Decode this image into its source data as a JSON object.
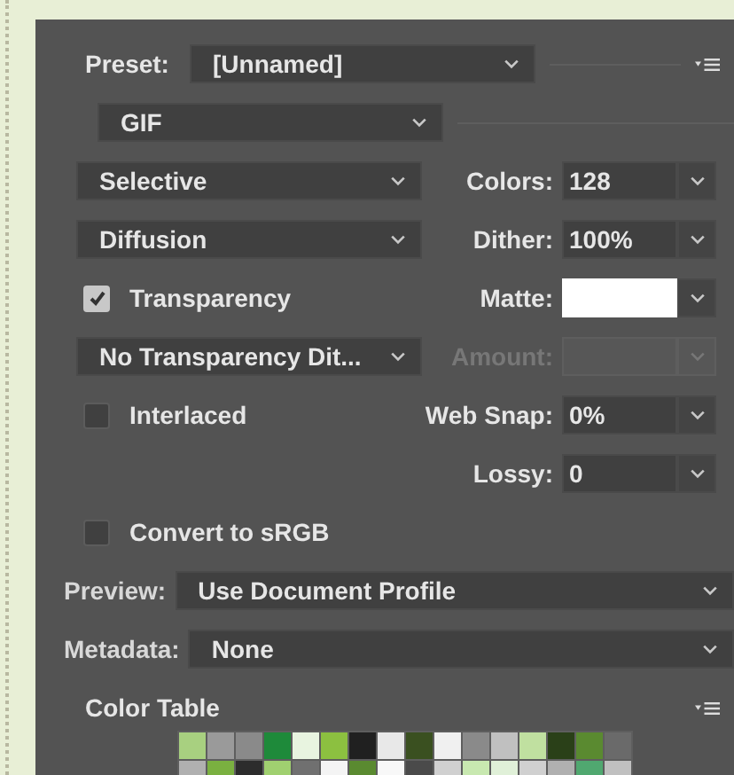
{
  "preset": {
    "label": "Preset:",
    "value": "[Unnamed]"
  },
  "format": {
    "value": "GIF"
  },
  "reduction": {
    "value": "Selective"
  },
  "colors": {
    "label": "Colors:",
    "value": "128"
  },
  "dither_algorithm": {
    "value": "Diffusion"
  },
  "dither": {
    "label": "Dither:",
    "value": "100%"
  },
  "transparency": {
    "label": "Transparency",
    "checked": true
  },
  "matte": {
    "label": "Matte:"
  },
  "transparency_dither": {
    "value": "No Transparency Dit..."
  },
  "amount": {
    "label": "Amount:",
    "disabled": true
  },
  "interlaced": {
    "label": "Interlaced",
    "checked": false
  },
  "web_snap": {
    "label": "Web Snap:",
    "value": "0%"
  },
  "lossy": {
    "label": "Lossy:",
    "value": "0"
  },
  "convert_srgb": {
    "label": "Convert to sRGB",
    "checked": false
  },
  "preview": {
    "label": "Preview:",
    "value": "Use Document Profile"
  },
  "metadata": {
    "label": "Metadata:",
    "value": "None"
  },
  "color_table": {
    "title": "Color Table",
    "swatches": [
      {
        "color": "#a8d080"
      },
      {
        "color": "#9a9a9a"
      },
      {
        "color": "#8a8a8a"
      },
      {
        "color": "#1e8a3a"
      },
      {
        "color": "#e8f4e0"
      },
      {
        "color": "#8cc040"
      },
      {
        "color": "#202020"
      },
      {
        "color": "#e8e8e8"
      },
      {
        "color": "#3a5020"
      },
      {
        "color": "#f0f0f0"
      },
      {
        "color": "#8a8a8a"
      },
      {
        "color": "#c0c0c0"
      },
      {
        "color": "#c0e0a0"
      },
      {
        "color": "#2a4018"
      },
      {
        "color": "#5a8a30"
      },
      {
        "color": "#6a6a6a"
      },
      {
        "color": "#b0b0b0"
      },
      {
        "color": "#7ab040"
      },
      {
        "color": "#2c2c2c"
      },
      {
        "color": "#a0d070"
      },
      {
        "color": "#707070"
      },
      {
        "color": "#f4f4f4"
      },
      {
        "color": "#5a8a30"
      },
      {
        "color": "#f8f8f8"
      },
      {
        "color": "#4a4a4a"
      },
      {
        "color": "#d0d0d0"
      },
      {
        "color": "#c8e8b0"
      },
      {
        "color": "#e0f0d8"
      },
      {
        "color": "#d0d0d0"
      },
      {
        "color": "#b0b0b0"
      },
      {
        "color": "#50a870"
      },
      {
        "color": "#c0c0c0"
      }
    ]
  }
}
